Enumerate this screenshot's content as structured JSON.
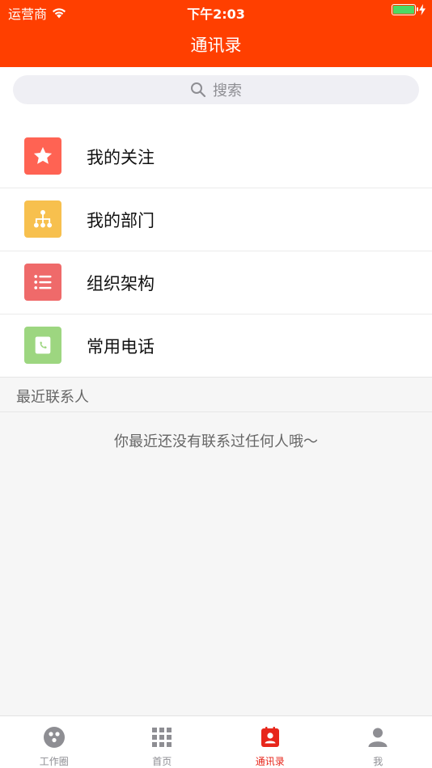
{
  "status_bar": {
    "carrier": "运营商",
    "time": "下午2:03"
  },
  "nav": {
    "title": "通讯录"
  },
  "search": {
    "placeholder": "搜索"
  },
  "menu": {
    "items": [
      {
        "label": "我的关注",
        "icon": "star-icon",
        "color": "#ff6353"
      },
      {
        "label": "我的部门",
        "icon": "org-tree-icon",
        "color": "#f7c04e"
      },
      {
        "label": "组织架构",
        "icon": "list-icon",
        "color": "#ef6a6a"
      },
      {
        "label": "常用电话",
        "icon": "phone-book-icon",
        "color": "#9dd680"
      }
    ]
  },
  "recent": {
    "header": "最近联系人",
    "empty_text": "你最近还没有联系过任何人哦～"
  },
  "tabs": [
    {
      "label": "工作圈",
      "icon": "circle-dots-icon",
      "active": false
    },
    {
      "label": "首页",
      "icon": "grid-icon",
      "active": false
    },
    {
      "label": "通讯录",
      "icon": "contacts-icon",
      "active": true
    },
    {
      "label": "我",
      "icon": "person-icon",
      "active": false
    }
  ],
  "colors": {
    "accent": "#ff3f00",
    "tab_active": "#e7261b",
    "tab_inactive": "#8e8e93"
  }
}
